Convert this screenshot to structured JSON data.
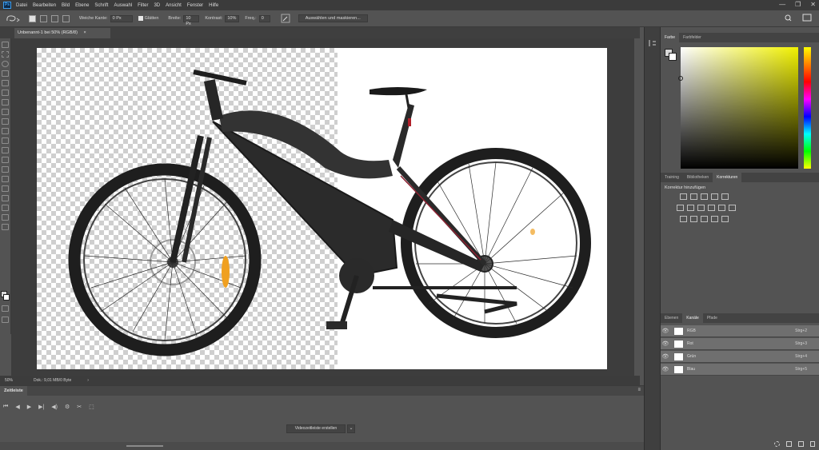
{
  "menubar": {
    "app_icon": "Ps",
    "items": [
      "Datei",
      "Bearbeiten",
      "Bild",
      "Ebene",
      "Schrift",
      "Auswahl",
      "Filter",
      "3D",
      "Ansicht",
      "Fenster",
      "Hilfe"
    ],
    "window_controls": [
      "—",
      "❐",
      "✕"
    ]
  },
  "options": {
    "soft_edge_label": "Weiche Kante:",
    "soft_edge_value": "0 Px",
    "smooth_label": "Glätten",
    "width_label": "Breite:",
    "width_value": "10 Px",
    "contrast_label": "Kontrast:",
    "contrast_value": "10%",
    "frequency_label": "Freq.:",
    "frequency_value": "0",
    "select_mask_button": "Auswählen und maskieren..."
  },
  "document": {
    "tab_title": "Unbenannt-1 bei 50% (RGB/8)",
    "tab_close": "×",
    "zoom": "50%",
    "doc_info": "Dok.: 9,01 MB/0 Byte"
  },
  "timeline": {
    "panel_title": "Zeitleiste",
    "create_button": "Videozeitleiste erstellen",
    "controls": [
      "⏮",
      "◀",
      "▶",
      "▶|",
      "◀)",
      "⚙",
      "✂",
      "⬚"
    ]
  },
  "color_panel": {
    "tabs": [
      "Farbe",
      "Farbfelder"
    ],
    "active_tab": "Farbe",
    "foreground": "#d8d8d8",
    "background": "#ffffff"
  },
  "adjust_panel": {
    "tabs": [
      "Training",
      "Bibliotheken",
      "Korrekturen"
    ],
    "active_tab": "Korrekturen",
    "heading": "Korrektur hinzufügen"
  },
  "channels_panel": {
    "tabs": [
      "Ebenen",
      "Kanäle",
      "Pfade"
    ],
    "active_tab": "Kanäle",
    "channels": [
      {
        "name": "RGB",
        "shortcut": "Strg+2"
      },
      {
        "name": "Rot",
        "shortcut": "Strg+3"
      },
      {
        "name": "Grün",
        "shortcut": "Strg+4"
      },
      {
        "name": "Blau",
        "shortcut": "Strg+5"
      }
    ]
  },
  "colors": {
    "chrome_dark": "#3b3b3b",
    "chrome_mid": "#535353",
    "accent_ps": "#3c9ef0"
  }
}
